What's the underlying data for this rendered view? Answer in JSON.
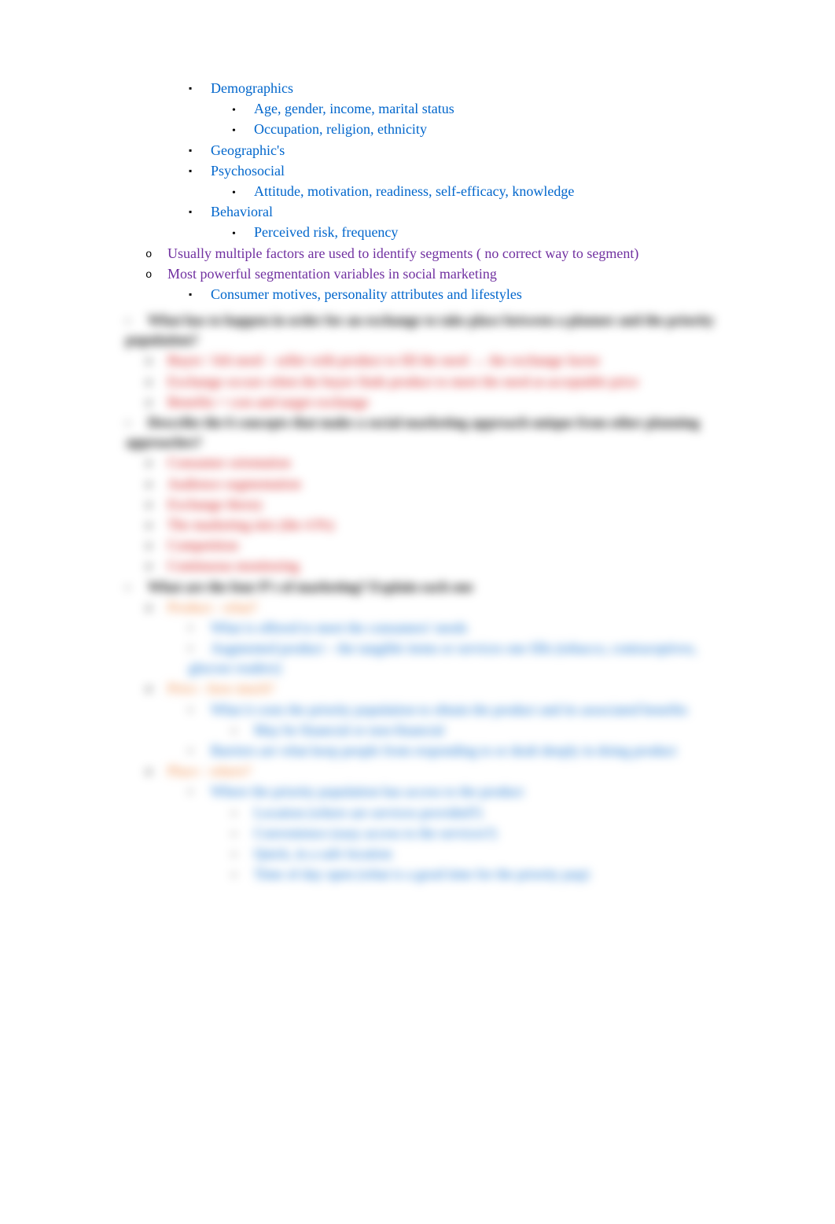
{
  "clear": {
    "demographics": "Demographics",
    "demo_sub1": "Age, gender, income, marital status",
    "demo_sub2": "Occupation, religion, ethnicity",
    "geographics": "Geographic's",
    "psychosocial": "Psychosocial",
    "psycho_sub1": "Attitude, motivation, readiness, self-efficacy, knowledge",
    "behavioral": "Behavioral",
    "behavioral_sub1": "Perceived risk, frequency",
    "multiple_factors": "Usually multiple factors are used to identify segments ( no correct way to segment)",
    "most_powerful": "Most powerful segmentation variables in social marketing",
    "consumer_motives": "Consumer motives, personality attributes and lifestyles"
  },
  "blurred": {
    "q1": "What has to happen in order for an exchange to take place between a planner and the priority population?",
    "q1_a": "Buyer / felt need – seller with product to fill the need → the exchange factor",
    "q1_b": "Exchange occurs when the buyer finds product to meet the need at acceptable price",
    "q1_c": "Benefits = cost and target exchange",
    "q2": "Describe the 6 concepts that make a social marketing approach unique from other planning approaches?",
    "q2_a": "Consumer orientation",
    "q2_b": "Audience segmentation",
    "q2_c": "Exchange theory",
    "q2_d": "The marketing mix (the 4 Ps)",
    "q2_e": "Competition",
    "q2_f": "Continuous monitoring",
    "q3": "What are the four P's of marketing? Explain each one",
    "product": "Product - what?",
    "product_a": "What is offered to meet the consumers' needs",
    "product_b": "Augmented product – the tangible items or services one fills (tobacco, contraceptives, glucose readers)",
    "price": "Price - how much?",
    "price_a": "What it costs the priority population to obtain the product and its associated benefits",
    "price_a_sub": "May be financial or non-financial",
    "price_b": "Barriers are what keep people from responding to or dealt deeply in doing product",
    "place": "Place - where?",
    "place_a": "Where the priority population has access to the product",
    "place_a_1": "Location (where are services provided?)",
    "place_a_2": "Convenience (easy access to the services?)",
    "place_a_3": "Quick, in a safe location",
    "place_a_4": "Time of day open (what is a good time for the priority pop)"
  }
}
